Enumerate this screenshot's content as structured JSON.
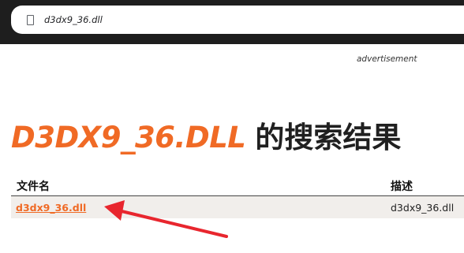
{
  "browser": {
    "url": "d3dx9_36.dll"
  },
  "page": {
    "advertisement_label": "advertisement",
    "heading_query": "D3DX9_36.DLL",
    "heading_suffix": "的搜索结果"
  },
  "table": {
    "columns": [
      "文件名",
      "描述"
    ],
    "rows": [
      {
        "filename": "d3dx9_36.dll",
        "description": "d3dx9_36.dll"
      }
    ]
  },
  "colors": {
    "accent": "#f06a25",
    "arrow": "#e8262e",
    "row_bg": "#f1eeeb",
    "topbar": "#1e1e1e"
  }
}
